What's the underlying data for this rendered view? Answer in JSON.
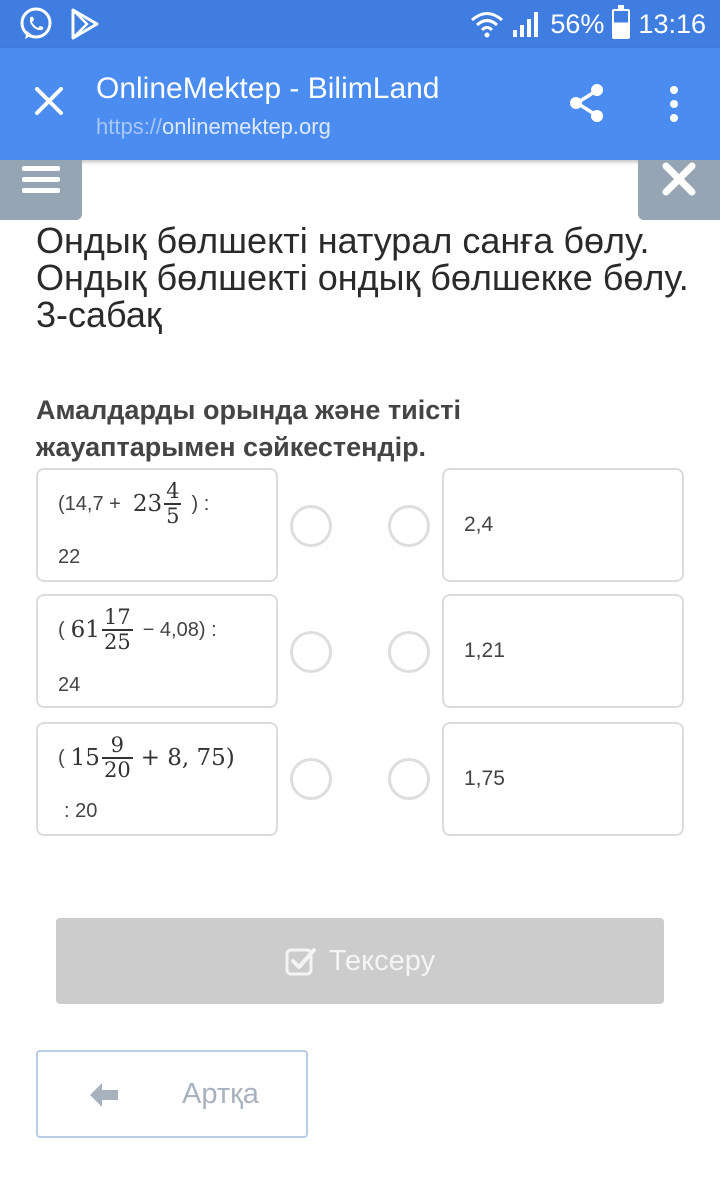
{
  "status_bar": {
    "battery": "56%",
    "time": "13:16"
  },
  "app_bar": {
    "title": "OnlineMektep - BilimLand",
    "url_protocol": "https://",
    "url_domain": "onlinemektep.org"
  },
  "lesson": {
    "title": "Ондық бөлшекті натурал санға бөлу. Ондық бөлшекті ондық бөлшекке бөлу. 3-сабақ",
    "instruction": "Амалдарды орында және тиісті жауаптарымен сәйкестендір."
  },
  "questions": [
    {
      "open": "(14,7 +",
      "whole": "23",
      "num": "4",
      "den": "5",
      "close": ") :",
      "divisor": "22"
    },
    {
      "open": "(",
      "whole": "61",
      "num": "17",
      "den": "25",
      "close": "− 4,08) :",
      "divisor": "24"
    },
    {
      "open": "(",
      "whole": "15",
      "num": "9",
      "den": "20",
      "close": "+ 8, 75)",
      "divisor": ": 20"
    }
  ],
  "answers": [
    "2,4",
    "1,21",
    "1,75"
  ],
  "buttons": {
    "check": "Тексеру",
    "back": "Артқа"
  },
  "colors": {
    "status_bar": "#3f7ee0",
    "app_bar": "#4a8cf0",
    "page_button": "#95a5b3",
    "check_button": "#cccccc"
  },
  "icons": {
    "status_left": [
      "whatsapp-icon",
      "play-store-icon"
    ],
    "status_right": [
      "wifi-icon",
      "signal-icon",
      "battery-icon"
    ],
    "app_bar": [
      "close-icon",
      "share-icon",
      "more-vert-icon"
    ],
    "page": [
      "menu-icon",
      "close-icon",
      "checkbox-icon",
      "arrow-left-icon"
    ]
  }
}
